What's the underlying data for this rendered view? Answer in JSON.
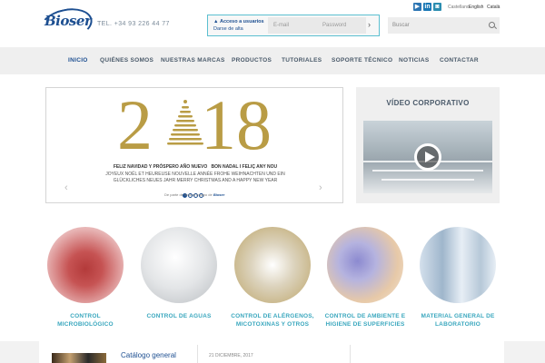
{
  "header": {
    "logo_text": "Bioser",
    "phone": "TEL. +34 93 226 44 77",
    "languages": [
      "Castellano",
      "English",
      "Català"
    ],
    "social": [
      "youtube",
      "linkedin",
      "slideshare"
    ]
  },
  "login": {
    "access_label": "Acceso a usuarios",
    "register_label": "Darse de alta",
    "email_placeholder": "E-mail",
    "password_placeholder": "Password"
  },
  "search": {
    "placeholder": "Buscar"
  },
  "nav": {
    "items": [
      "INICIO",
      "QUIÉNES SOMOS",
      "NUESTRAS MARCAS",
      "PRODUCTOS",
      "TUTORIALES",
      "SOPORTE TÉCNICO",
      "NOTICIAS",
      "CONTACTAR"
    ],
    "active": "INICIO"
  },
  "slider": {
    "year_left": "2",
    "year_right": "18",
    "greeting_line1_a": "FELIZ NAVIDAD Y PRÓSPERO AÑO NUEVO",
    "greeting_line1_b": "BON NADAL I FELIÇ ANY NOU",
    "greeting_line2": "JOYEUX NOËL ET HEUREUSE NOUVELLE ANNÉE   FROHE WEIHNACHTEN UND EIN",
    "greeting_line3": "GLÜCKLICHES NEUES JAHR   MERRY CHRISTMAS AND A HAPPY NEW YEAR",
    "sign": "De parte de todo el equipo de",
    "slide_count": 4,
    "current_slide": 1
  },
  "video": {
    "title": "VÍDEO CORPORATIVO"
  },
  "categories": [
    {
      "label_1": "CONTROL",
      "label_2": "MICROBIOLÓGICO",
      "color_a": "#d98a8a",
      "color_b": "#b33a3a"
    },
    {
      "label_1": "CONTROL DE AGUAS",
      "label_2": "",
      "color_a": "#eeeeee",
      "color_b": "#b8bcc0"
    },
    {
      "label_1": "CONTROL DE ALÉRGENOS,",
      "label_2": "MICOTOXINAS Y OTROS",
      "color_a": "#f1e8d4",
      "color_b": "#c9b78a"
    },
    {
      "label_1": "CONTROL DE AMBIENTE E",
      "label_2": "HIGIENE DE SUPERFICIES",
      "color_a": "#f3e6d6",
      "color_b": "#8c8ad0"
    },
    {
      "label_1": "MATERIAL GENERAL DE",
      "label_2": "LABORATORIO",
      "color_a": "#e7eef5",
      "color_b": "#9fb6cc"
    }
  ],
  "bottom": {
    "catalog": "Catálogo general",
    "date": "21 DICIEMBRE, 2017"
  }
}
